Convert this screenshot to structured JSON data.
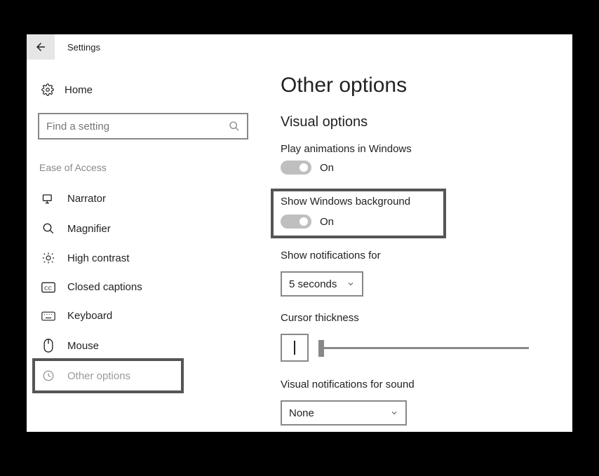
{
  "titlebar": {
    "title": "Settings"
  },
  "sidebar": {
    "home_label": "Home",
    "search_placeholder": "Find a setting",
    "section_label": "Ease of Access",
    "items": [
      {
        "label": "Narrator"
      },
      {
        "label": "Magnifier"
      },
      {
        "label": "High contrast"
      },
      {
        "label": "Closed captions"
      },
      {
        "label": "Keyboard"
      },
      {
        "label": "Mouse"
      },
      {
        "label": "Other options"
      }
    ]
  },
  "main": {
    "page_title": "Other options",
    "section_title": "Visual options",
    "play_animations": {
      "label": "Play animations in Windows",
      "state": "On"
    },
    "show_background": {
      "label": "Show Windows background",
      "state": "On"
    },
    "notifications": {
      "label": "Show notifications for",
      "value": "5 seconds"
    },
    "cursor": {
      "label": "Cursor thickness"
    },
    "visual_notifications": {
      "label": "Visual notifications for sound",
      "value": "None"
    }
  }
}
